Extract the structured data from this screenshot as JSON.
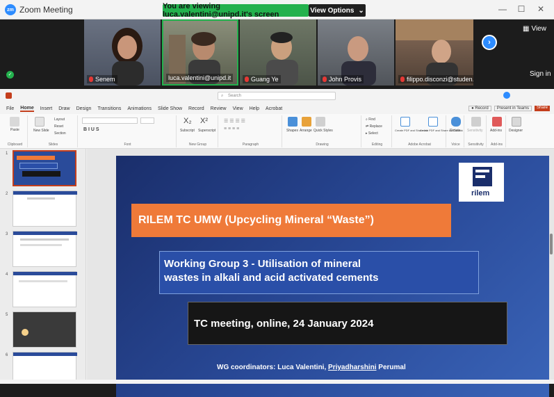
{
  "zoom": {
    "title": "Zoom Meeting",
    "banner": "You are viewing luca.valentini@unipd.it's screen",
    "view_options": "View Options",
    "view": "View",
    "sign_in": "Sign in",
    "participants": [
      {
        "name": "Senem"
      },
      {
        "name": "luca.valentini@unipd.it"
      },
      {
        "name": "Guang Ye"
      },
      {
        "name": "John Provis"
      },
      {
        "name": "filippo.disconzi@studen..."
      }
    ]
  },
  "ppt": {
    "search_placeholder": "Search",
    "menu": [
      "File",
      "Home",
      "Insert",
      "Draw",
      "Design",
      "Transitions",
      "Animations",
      "Slide Show",
      "Record",
      "Review",
      "View",
      "Help",
      "Acrobat"
    ],
    "record_btn": "Record",
    "present_btn": "Present in Teams",
    "share_btn": "Share",
    "ribbon_groups": [
      "Clipboard",
      "Slides",
      "Font",
      "New Group",
      "Paragraph",
      "Drawing",
      "Editing",
      "Adobe Acrobat",
      "Voice",
      "Sensitivity",
      "Add-ins"
    ],
    "ribbon_buttons": {
      "paste": "Paste",
      "new_slide": "New Slide",
      "layout": "Layout",
      "reset": "Reset",
      "section": "Section",
      "subscript": "Subscript",
      "superscript": "Superscript",
      "shapes": "Shapes",
      "arrange": "Arrange",
      "quick_styles": "Quick Styles",
      "find": "Find",
      "replace": "Replace",
      "select": "Select",
      "create_pdf": "Create PDF and Share link",
      "create_pdf_outlook": "Create PDF and Share via Outlook",
      "dictate": "Dictate",
      "sensitivity": "Sensitivity",
      "addins": "Add-ins",
      "designer": "Designer"
    },
    "slide": {
      "title": "RILEM TC UMW (Upcycling Mineral “Waste”)",
      "wg_line1": "Working Group 3 - Utilisation of mineral",
      "wg_line2": "wastes in alkali and acid activated cements",
      "meeting": "TC meeting, online, 24 January 2024",
      "coordinators_label": "WG coordinators: Luca Valentini,",
      "coordinator2": "Priyadharshini",
      "coordinator2_last": "Perumal",
      "logo_text": "rilem"
    },
    "thumbs": [
      {
        "num": "1"
      },
      {
        "num": "2"
      },
      {
        "num": "3"
      },
      {
        "num": "4"
      },
      {
        "num": "5"
      },
      {
        "num": "6"
      }
    ]
  }
}
